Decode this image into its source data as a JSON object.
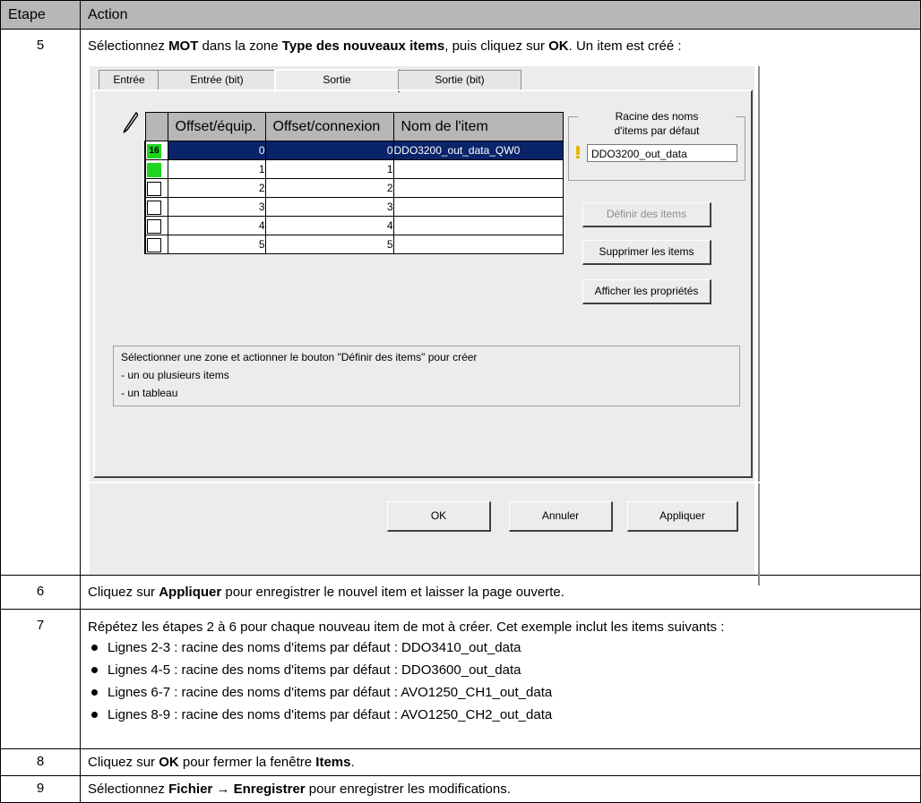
{
  "header": {
    "col1": "Etape",
    "col2": "Action"
  },
  "step5": {
    "num": "5",
    "text_a": "Sélectionnez ",
    "b1": "MOT",
    "text_b": " dans la zone ",
    "b2": "Type des nouveaux items",
    "text_c": ", puis cliquez sur ",
    "b3": "OK",
    "text_d": ". Un item est créé :"
  },
  "dialog": {
    "tabs": [
      "Entrée",
      "Entrée (bit)",
      "Sortie",
      "Sortie (bit)"
    ],
    "grid": {
      "headers": [
        "Offset/équip.",
        "Offset/connexion",
        "Nom de l'item"
      ],
      "rows": [
        {
          "a": "0",
          "b": "0",
          "name": "DDO3200_out_data_QW0",
          "check": "16"
        },
        {
          "a": "1",
          "b": "1",
          "name": "",
          "check": ""
        },
        {
          "a": "2",
          "b": "2",
          "name": "",
          "check": ""
        },
        {
          "a": "3",
          "b": "3",
          "name": "",
          "check": ""
        },
        {
          "a": "4",
          "b": "4",
          "name": "",
          "check": ""
        },
        {
          "a": "5",
          "b": "5",
          "name": "",
          "check": ""
        }
      ]
    },
    "root_group": {
      "line1": "Racine des noms",
      "line2": "d'items par défaut",
      "value": "DDO3200_out_data"
    },
    "buttons": {
      "define": "Définir des items",
      "delete": "Supprimer les items",
      "props": "Afficher les propriétés",
      "ok": "OK",
      "cancel": "Annuler",
      "apply": "Appliquer"
    },
    "info": [
      "Sélectionner une zone et actionner le bouton \"Définir des items\" pour créer",
      "- un ou plusieurs items",
      "- un tableau"
    ],
    "colors": {
      "selection": "#0a246a",
      "green": "#1ed41e"
    }
  },
  "step6": {
    "num": "6",
    "a": "Cliquez sur ",
    "b": "Appliquer",
    "c": " pour enregistrer le nouvel item et laisser la page ouverte."
  },
  "step7": {
    "num": "7",
    "intro": "Répétez les étapes 2 à 6 pour chaque nouveau item de mot à créer. Cet exemple inclut les items suivants :",
    "bullets": [
      "Lignes 2-3 : racine des noms d'items par défaut : DDO3410_out_data",
      "Lignes 4-5 : racine des noms d'items par défaut : DDO3600_out_data",
      "Lignes 6-7 : racine des noms d'items par défaut : AVO1250_CH1_out_data",
      "Lignes 8-9 : racine des noms d'items par défaut : AVO1250_CH2_out_data"
    ]
  },
  "step8": {
    "num": "8",
    "a": "Cliquez sur ",
    "b": "OK",
    "c": " pour fermer la fenêtre ",
    "d": "Items",
    "e": "."
  },
  "step9": {
    "num": "9",
    "a": "Sélectionnez ",
    "b": "Fichier",
    "arrow": " → ",
    "c": "Enregistrer",
    "d": " pour enregistrer les modifications."
  }
}
